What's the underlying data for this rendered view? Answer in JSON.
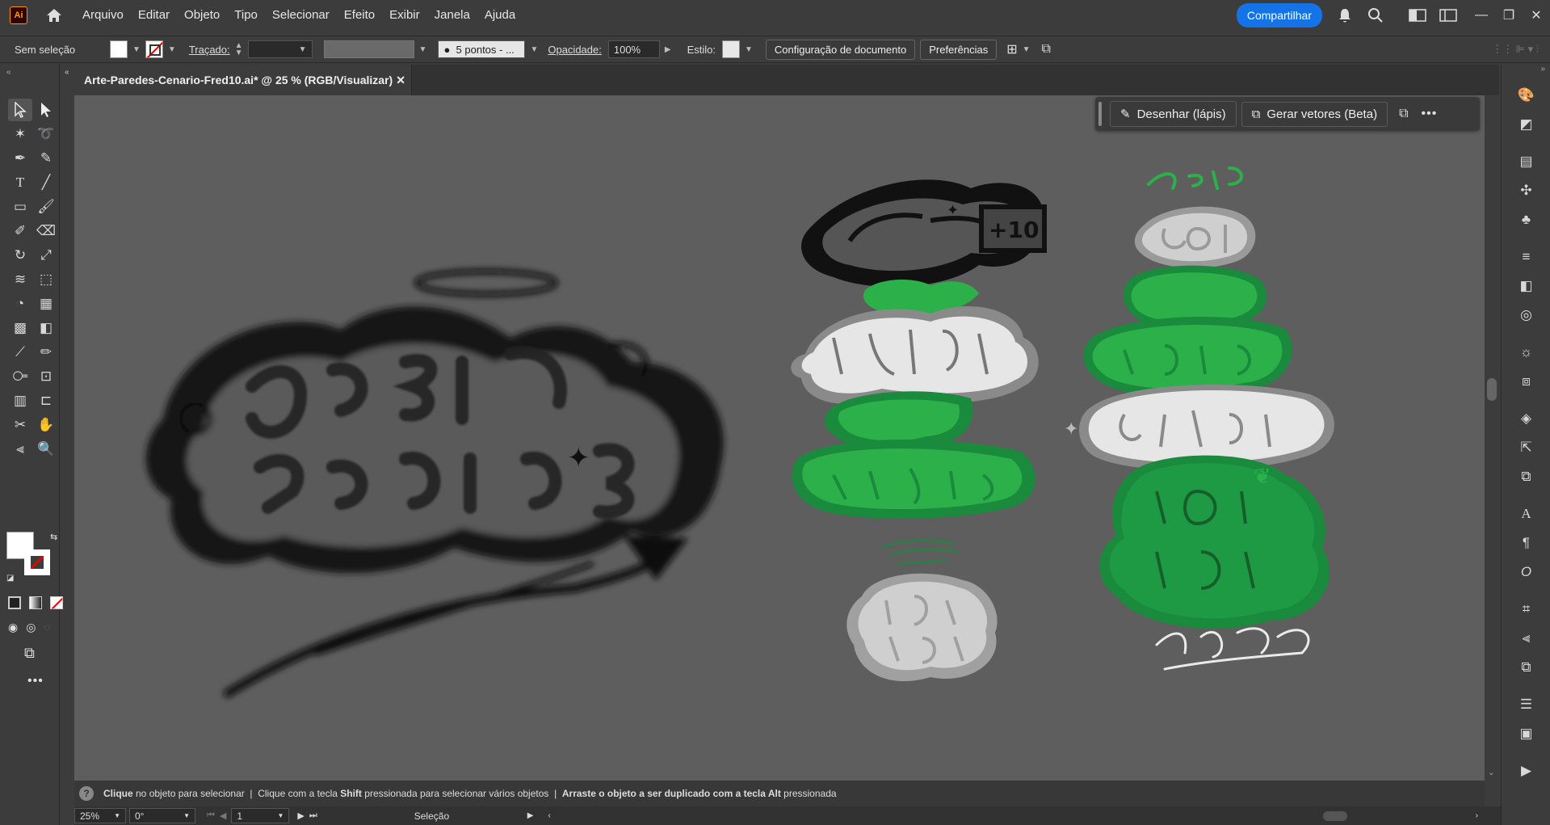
{
  "menubar": {
    "logo": "Ai",
    "items": [
      "Arquivo",
      "Editar",
      "Objeto",
      "Tipo",
      "Selecionar",
      "Efeito",
      "Exibir",
      "Janela",
      "Ajuda"
    ],
    "share_label": "Compartilhar"
  },
  "control": {
    "selection": "Sem seleção",
    "stroke_label": "Traçado:",
    "brush_label": "5 pontos - ...",
    "opacity_label": "Opacidade:",
    "opacity_value": "100%",
    "style_label": "Estilo:",
    "doc_setup": "Configuração de documento",
    "preferences": "Preferências"
  },
  "document": {
    "tab_title": "Arte-Paredes-Cenario-Fred10.ai* @ 25 % (RGB/Visualizar)"
  },
  "context_bar": {
    "draw_label": "Desenhar (lápis)",
    "vectors_label": "Gerar vetores (Beta)"
  },
  "status": {
    "help_1a": "Clique",
    "help_1b": " no objeto para selecionar",
    "help_2a": "Clique com a tecla ",
    "help_2b": "Shift",
    "help_2c": " pressionada para selecionar vários objetos",
    "help_3a": "Arraste o objeto a ser duplicado com a tecla ",
    "help_3b": "Alt",
    "help_3c": " pressionada"
  },
  "bottom": {
    "zoom": "25%",
    "rotation": "0°",
    "artboard": "1",
    "mode": "Seleção"
  },
  "colors": {
    "canvas": "#5e5e5e",
    "accent": "#1473e6",
    "green_dark": "#1a8a3c",
    "green_light": "#2bb04a",
    "ink": "#111111",
    "fill_light": "#e6e6e6",
    "fill_grey": "#cfcfcf"
  }
}
